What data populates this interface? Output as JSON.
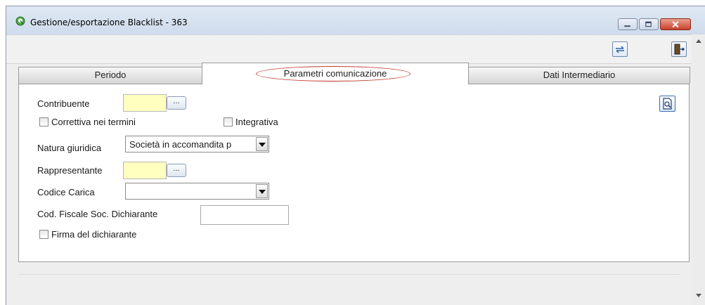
{
  "window": {
    "title": "Gestione/esportazione Blacklist - 363"
  },
  "tabs": [
    {
      "label": "Periodo",
      "active": false
    },
    {
      "label": "Parametri comunicazione",
      "active": true
    },
    {
      "label": "Dati Intermediario",
      "active": false
    }
  ],
  "form": {
    "contribuente_label": "Contribuente",
    "dots_label": "...",
    "correttiva_label": "Correttiva nei termini",
    "integrativa_label": "Integrativa",
    "natura_label": "Natura giuridica",
    "natura_value": "Società in accomandita p",
    "rappresentante_label": "Rappresentante",
    "codice_carica_label": "Codice Carica",
    "codice_carica_value": "",
    "cod_fiscale_label": "Cod. Fiscale Soc. Dichiarante",
    "cod_fiscale_value": "",
    "firma_label": "Firma del dichiarante"
  },
  "colors": {
    "highlight_oval": "#c0392b",
    "required_field": "#ffffc0",
    "close_button": "#c8412d"
  }
}
